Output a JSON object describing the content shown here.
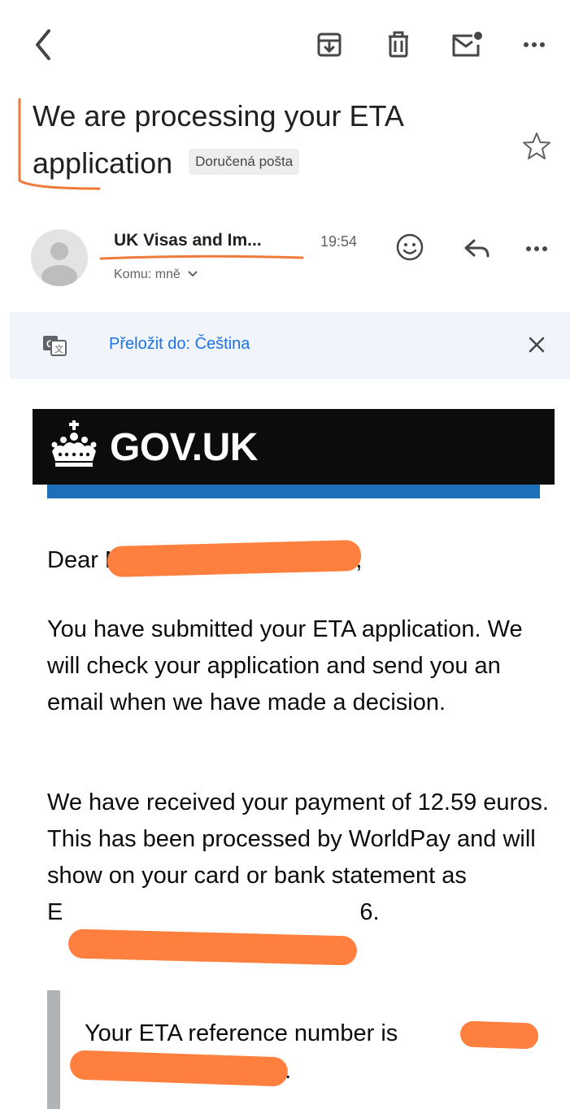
{
  "toolbar": {
    "back": "back-arrow-icon",
    "archive": "archive-icon",
    "delete": "trash-icon",
    "mark_unread": "mark-unread-icon",
    "more": "more-icon"
  },
  "email": {
    "subject": "We are processing your ETA application",
    "label": "Doručená pošta",
    "sender_name": "UK Visas and Im...",
    "time": "19:54",
    "recipient": "Komu: mně"
  },
  "translate": {
    "link": "Přeložit do: Čeština"
  },
  "gov": {
    "title": "GOV.UK"
  },
  "body": {
    "greeting_start": "Dear M",
    "greeting_end": "A,",
    "para1": "You have submitted your ETA application. We will check your application and send you an email when we have made a decision.",
    "para2": "We have received your payment of 12.59 euros. This has been processed by WorldPay and will show on your card or bank statement as",
    "statement_start": "E",
    "statement_end": "6.",
    "reference_text": "Your ETA reference number is",
    "reference_end": "5."
  },
  "colors": {
    "gov_black": "#0b0c0c",
    "gov_blue": "#1d70b8",
    "link_blue": "#1a73e8",
    "redaction": "#ff7f3f"
  }
}
